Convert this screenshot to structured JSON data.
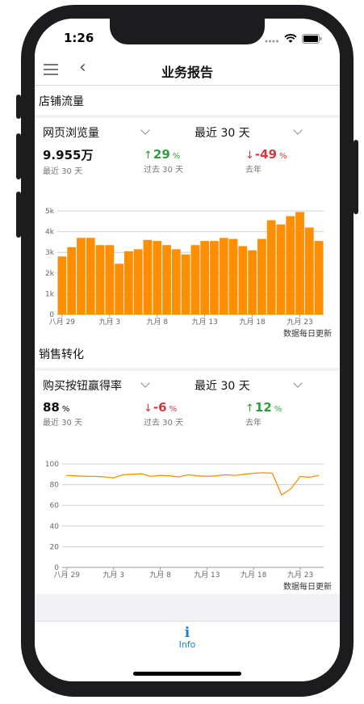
{
  "status": {
    "time": "1:26"
  },
  "nav": {
    "title": "业务报告"
  },
  "sections": [
    {
      "title": "店铺流量",
      "metric_select": "网页浏览量",
      "period_select": "最近 30 天",
      "kpis": [
        {
          "value": "9.955万",
          "unit": "",
          "label": "最近 30 天"
        },
        {
          "value": "29",
          "unit": "%",
          "label": "过去 30 天",
          "direction": "up"
        },
        {
          "value": "-49",
          "unit": "%",
          "label": "去年",
          "direction": "down"
        }
      ],
      "footnote": "数据每日更新"
    },
    {
      "title": "销售转化",
      "metric_select": "购买按钮赢得率",
      "period_select": "最近 30 天",
      "kpis": [
        {
          "value": "88",
          "unit": "%",
          "label": "最近 30 天"
        },
        {
          "value": "-6",
          "unit": "%",
          "label": "过去 30 天",
          "direction": "down"
        },
        {
          "value": "12",
          "unit": "%",
          "label": "去年",
          "direction": "up"
        }
      ],
      "footnote": "数据每日更新"
    }
  ],
  "tabbar": {
    "info_icon": "i",
    "info_label": "Info"
  },
  "colors": {
    "accent": "#ff8f00",
    "up": "#2e9e3e",
    "down": "#d9363e",
    "link": "#1a7fd6"
  },
  "chart_data": [
    {
      "type": "bar",
      "x_tick_labels": [
        "八月 29",
        "九月 3",
        "九月 8",
        "九月 13",
        "九月 18",
        "九月 23"
      ],
      "y_tick_labels": [
        "0",
        "1k",
        "2k",
        "3k",
        "4k",
        "5k"
      ],
      "ylim": [
        0,
        5000
      ],
      "values": [
        2800,
        3250,
        3700,
        3700,
        3350,
        3350,
        2450,
        3050,
        3150,
        3600,
        3550,
        3350,
        3150,
        2900,
        3350,
        3550,
        3550,
        3700,
        3650,
        3300,
        3100,
        3650,
        4550,
        4350,
        4750,
        4950,
        4200,
        3550
      ],
      "grid": true
    },
    {
      "type": "line",
      "x_tick_labels": [
        "八月 29",
        "九月 3",
        "九月 8",
        "九月 13",
        "九月 18",
        "九月 23"
      ],
      "y_tick_labels": [
        "0",
        "20",
        "40",
        "60",
        "80",
        "100"
      ],
      "ylim": [
        0,
        100
      ],
      "values": [
        89,
        88.5,
        88,
        88,
        87.5,
        86.5,
        89.5,
        90,
        90.5,
        88,
        89,
        88.5,
        87.5,
        89.5,
        88.5,
        88,
        88.5,
        89.5,
        89,
        90,
        91,
        91.5,
        91,
        70,
        76,
        88,
        87,
        89
      ],
      "grid": true
    }
  ]
}
